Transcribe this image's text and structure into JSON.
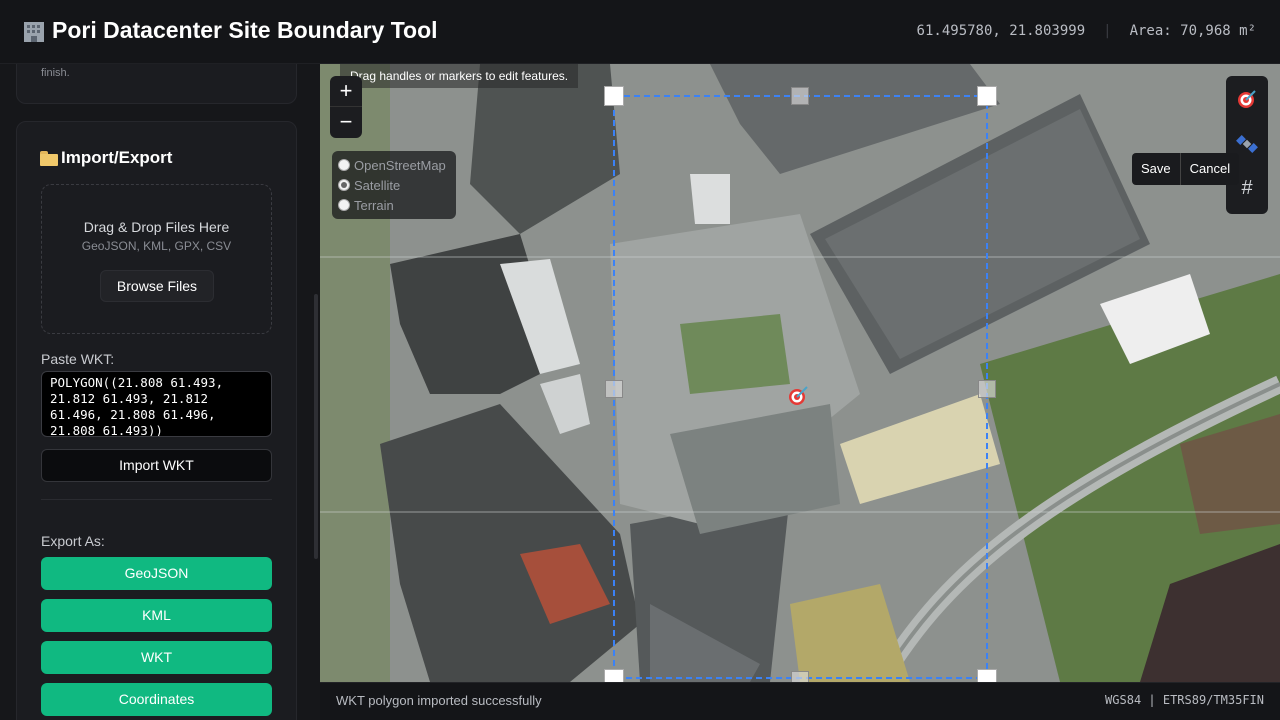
{
  "header": {
    "title": "Pori Datacenter Site Boundary Tool",
    "coordinates": "61.495780, 21.803999",
    "area": "Area: 70,968 m²"
  },
  "sidebar": {
    "prev_card_text": "finish.",
    "import_export": {
      "title": "Import/Export",
      "dropzone_title": "Drag & Drop Files Here",
      "dropzone_formats": "GeoJSON, KML, GPX, CSV",
      "browse_label": "Browse Files",
      "paste_label": "Paste WKT:",
      "wkt_value": "POLYGON((21.808 61.493, 21.812 61.493, 21.812 61.496, 21.808 61.496, 21.808 61.493))",
      "import_label": "Import WKT",
      "export_label": "Export As:",
      "export_buttons": [
        "GeoJSON",
        "KML",
        "WKT",
        "Coordinates"
      ]
    }
  },
  "map": {
    "hint": "Drag handles or markers to edit features.",
    "zoom_in": "+",
    "zoom_out": "−",
    "layers": [
      {
        "label": "OpenStreetMap",
        "selected": false
      },
      {
        "label": "Satellite",
        "selected": true
      },
      {
        "label": "Terrain",
        "selected": false
      }
    ],
    "tools": [
      "target-icon",
      "satellite-icon",
      "grid-icon"
    ],
    "grid_tool_label": "#",
    "edit_save": "Save",
    "edit_cancel": "Cancel",
    "boundary_color": "#3b82f6"
  },
  "status": {
    "message": "WKT polygon imported successfully",
    "crs": "WGS84 | ETRS89/TM35FIN"
  },
  "colors": {
    "accent_export": "#10b981",
    "background": "#121316"
  }
}
